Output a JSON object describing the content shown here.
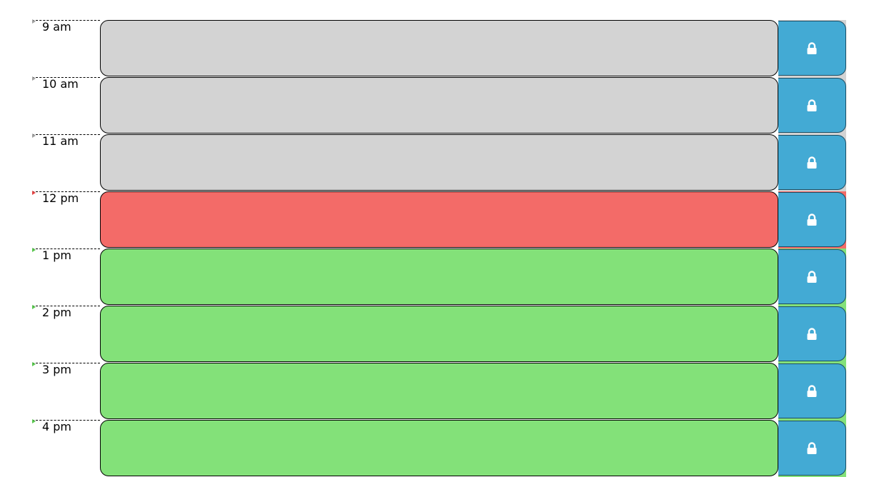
{
  "colors": {
    "past": "#d3d3d3",
    "present": "#f36b68",
    "future": "#83e179",
    "save_button": "#43aad4",
    "marker_past": "#a0a0a0",
    "marker_present": "#e34545",
    "marker_future": "#5bc650"
  },
  "lock_icon_name": "lock-icon",
  "rows": [
    {
      "hour": "9 am",
      "state": "past",
      "text": ""
    },
    {
      "hour": "10 am",
      "state": "past",
      "text": ""
    },
    {
      "hour": "11 am",
      "state": "past",
      "text": ""
    },
    {
      "hour": "12 pm",
      "state": "present",
      "text": ""
    },
    {
      "hour": "1 pm",
      "state": "future",
      "text": ""
    },
    {
      "hour": "2 pm",
      "state": "future",
      "text": ""
    },
    {
      "hour": "3 pm",
      "state": "future",
      "text": ""
    },
    {
      "hour": "4 pm",
      "state": "future",
      "text": ""
    }
  ]
}
